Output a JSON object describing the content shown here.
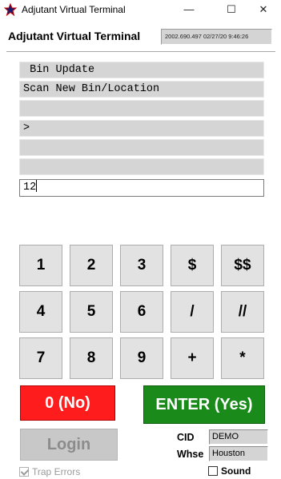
{
  "window": {
    "title": "Adjutant Virtual Terminal",
    "controls": {
      "minimize": "—",
      "maximize": "☐",
      "close": "✕"
    },
    "icon": "star-app-icon"
  },
  "header": {
    "title": "Adjutant Virtual Terminal",
    "stamp": "2002.690.497 02/27/20  9:46:26"
  },
  "terminal": {
    "lines": [
      " Bin Update",
      "Scan New Bin/Location",
      "",
      ">",
      "",
      ""
    ],
    "input_value": "12"
  },
  "keypad": {
    "rows": [
      [
        "1",
        "2",
        "3",
        "$",
        "$$"
      ],
      [
        "4",
        "5",
        "6",
        "/",
        "//"
      ],
      [
        "7",
        "8",
        "9",
        "+",
        "*"
      ]
    ]
  },
  "actions": {
    "no_label": "0 (No)",
    "yes_label": "ENTER (Yes)",
    "login_label": "Login"
  },
  "info": {
    "cid_label": "CID",
    "cid_value": "DEMO",
    "whse_label": "Whse",
    "whse_value": "Houston"
  },
  "options": {
    "trap_errors_label": "Trap Errors",
    "trap_errors_checked": true,
    "sound_label": "Sound",
    "sound_checked": false
  },
  "colors": {
    "no_button": "#ff1c1c",
    "yes_button": "#1a8a1a",
    "line_bg": "#d5d5d5",
    "key_bg": "#e2e2e2"
  }
}
